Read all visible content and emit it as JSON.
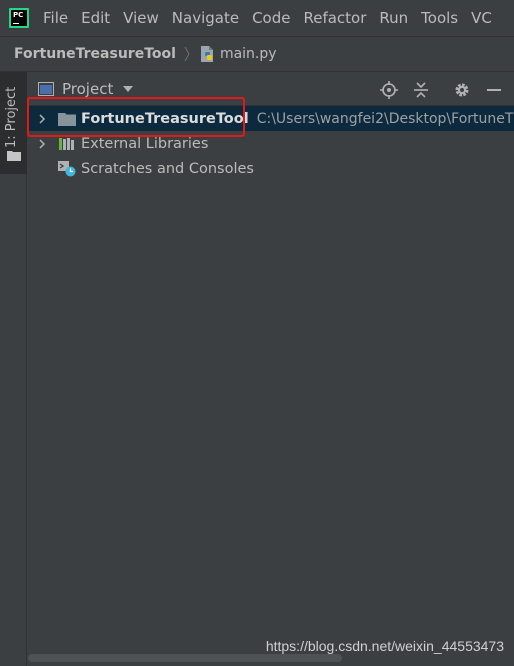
{
  "menubar": {
    "logo_text": "PC",
    "items": [
      "File",
      "Edit",
      "View",
      "Navigate",
      "Code",
      "Refactor",
      "Run",
      "Tools",
      "VC"
    ]
  },
  "navbar": {
    "project": "FortuneTreasureTool",
    "file": "main.py",
    "file_icon": "python-file-icon"
  },
  "toolstrip": {
    "tab_label": "1: Project"
  },
  "panel": {
    "title": "Project",
    "header_icons": [
      "locate-icon",
      "collapse-all-icon",
      "gear-icon",
      "minimize-icon"
    ]
  },
  "tree": {
    "root": {
      "label": "FortuneTreasureTool",
      "path": "C:\\Users\\wangfei2\\Desktop\\FortuneT",
      "icon": "folder-icon"
    },
    "external": {
      "label": "External Libraries",
      "icon": "libraries-icon"
    },
    "scratches": {
      "label": "Scratches and Consoles",
      "icon": "scratches-icon"
    }
  },
  "watermark": "https://blog.csdn.net/weixin_44553473",
  "colors": {
    "background": "#3c3f41",
    "selection": "#0d293e",
    "highlight_border": "#e0191b",
    "logo_green": "#21d789"
  }
}
